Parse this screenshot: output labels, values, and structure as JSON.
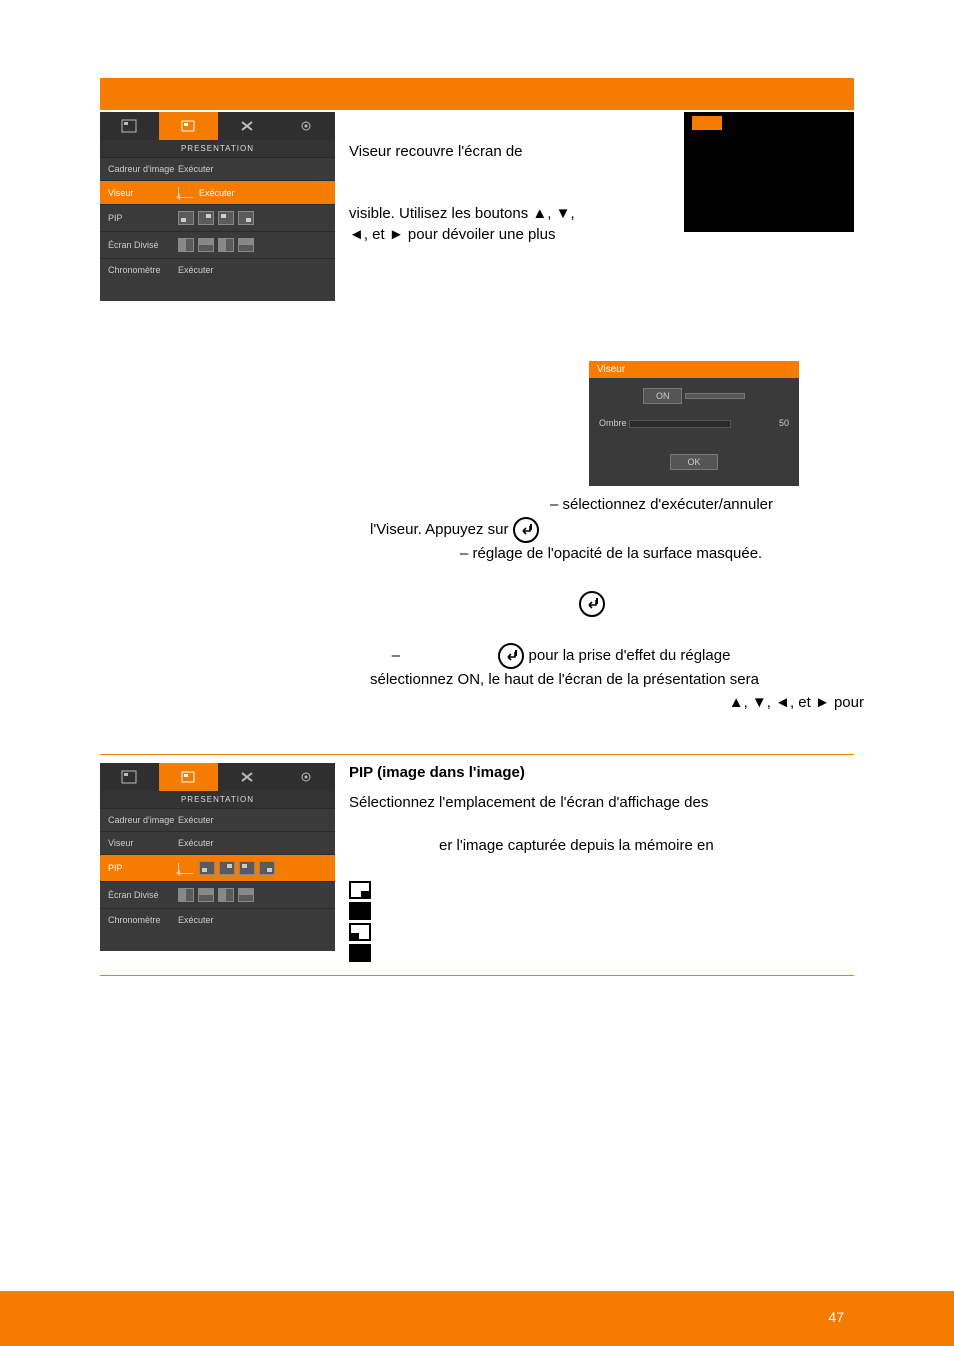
{
  "osd_menu": {
    "title": "PRESENTATION",
    "rows": [
      {
        "label": "Cadreur d'image",
        "value": "Exécuter"
      },
      {
        "label": "Viseur",
        "value": "Exécuter"
      },
      {
        "label": "PIP",
        "value": ""
      },
      {
        "label": "Écran Divisé",
        "value": ""
      },
      {
        "label": "Chronomètre",
        "value": "Exécuter"
      }
    ]
  },
  "viseur_text": {
    "p1": "Viseur recouvre l'écran de",
    "p2": "visible. Utilisez les boutons ▲, ▼,",
    "p3": "◄, et ► pour dévoiler une plus"
  },
  "sub_panel": {
    "title": "Viseur",
    "on": "ON",
    "shadow_label": "Ombre",
    "shadow_value": "50",
    "ok": "OK"
  },
  "sub_text": {
    "line1a": " – sélectionnez d'exécuter/annuler",
    "line2a": "l'Viseur. Appuyez sur ",
    "line3": " – réglage de l'opacité de la surface masquée.",
    "line_dash": "–",
    "line4": " pour la prise d'effet du réglage",
    "line5": "sélectionnez ON, le haut de l'écran de la présentation sera",
    "line6": "▲, ▼, ◄, et ► pour"
  },
  "pip": {
    "heading": "PIP (image dans l'image)",
    "p1": "Sélectionnez l'emplacement de l'écran d'affichage des",
    "p2": "er l'image capturée depuis la mémoire en"
  },
  "footer_page": "47"
}
